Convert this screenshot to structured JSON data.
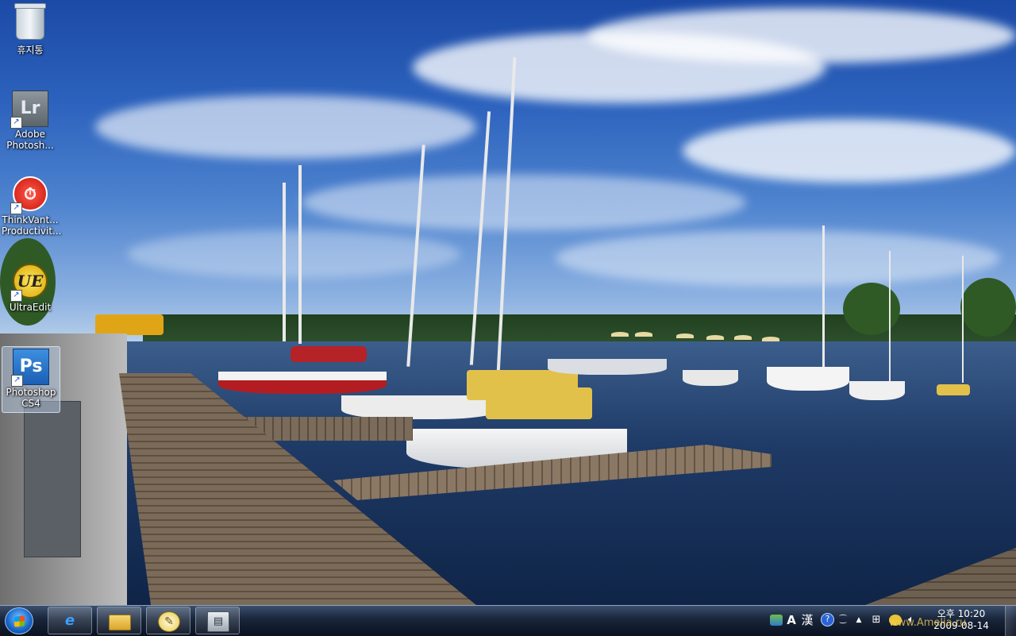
{
  "desktop": {
    "wallpaper": "marina with sailboats, wooden docks and cloudy blue sky",
    "icons": [
      {
        "label": "휴지통",
        "icon": "recycle-bin-icon"
      },
      {
        "label": "Adobe Photosh...",
        "icon": "lightroom-icon",
        "glyph": "Lr"
      },
      {
        "label": "ThinkVant... Productivit...",
        "icon": "thinkvantage-icon",
        "glyph": "⏱"
      },
      {
        "label": "UltraEdit",
        "icon": "ultraedit-icon",
        "glyph": "UE"
      },
      {
        "label": "Photoshop CS4",
        "icon": "photoshop-icon",
        "glyph": "Ps"
      }
    ]
  },
  "taskbar": {
    "start_button": "start-orb-icon",
    "pinned": [
      {
        "name": "internet-explorer",
        "icon": "internet-explorer-icon",
        "glyph": "e"
      },
      {
        "name": "windows-explorer",
        "icon": "folder-icon",
        "glyph": ""
      },
      {
        "name": "messenger",
        "icon": "messenger-icon",
        "glyph": "✎"
      },
      {
        "name": "app",
        "icon": "application-icon",
        "glyph": "▤"
      }
    ],
    "tray": {
      "ime_mode": "A",
      "ime_hanja": "漢",
      "help": "?",
      "time": "오후 10:20",
      "date": "2009-08-14"
    }
  },
  "watermark": "www.Amelia.ru",
  "colors": {
    "taskbar_top": "#3c4e68",
    "taskbar_bottom": "#0a101c",
    "sky": "#2c62bd",
    "water": "#1e3a66"
  }
}
